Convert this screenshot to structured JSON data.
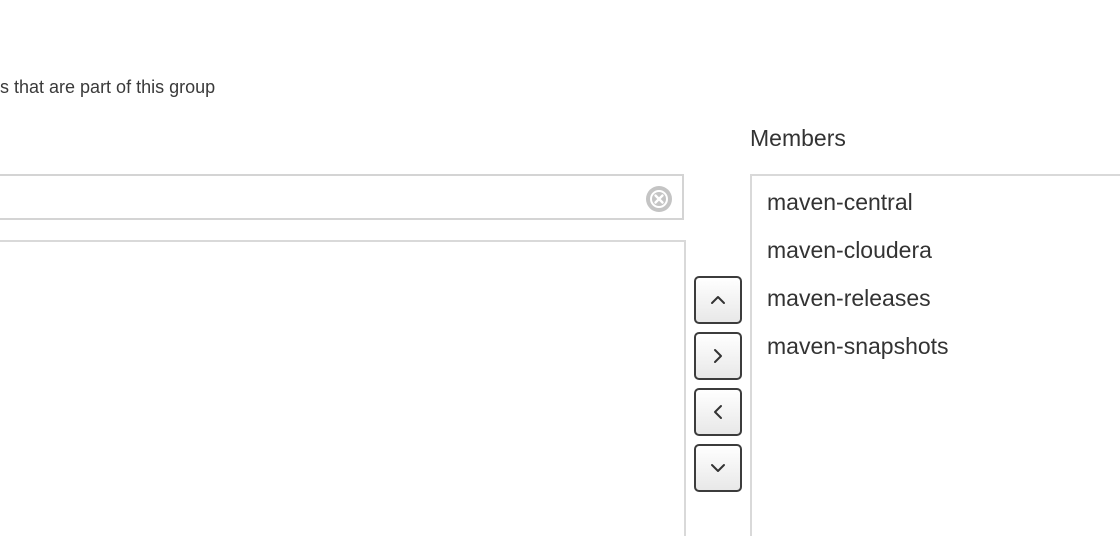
{
  "help_text": "s that are part of this group",
  "members": {
    "heading": "Members",
    "items": [
      {
        "label": "maven-central"
      },
      {
        "label": "maven-cloudera"
      },
      {
        "label": "maven-releases"
      },
      {
        "label": "maven-snapshots"
      }
    ]
  },
  "filter": {
    "value": "",
    "placeholder": "",
    "clear_icon": "clear-circle-icon"
  },
  "controls": {
    "move_up_icon": "chevron-up-icon",
    "add_icon": "chevron-right-icon",
    "remove_icon": "chevron-left-icon",
    "move_down_icon": "chevron-down-icon"
  },
  "colors": {
    "border": "#d9d9d9",
    "button_border": "#3c3c3c",
    "clear_icon": "#c4c4c4",
    "text": "#333333"
  }
}
